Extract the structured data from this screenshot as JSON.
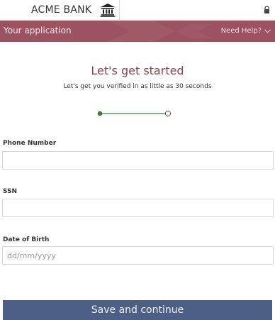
{
  "header": {
    "bank_name": "ACME BANK",
    "bank_icon": "bank-building-icon",
    "lock_icon": "lock-icon"
  },
  "appbar": {
    "title": "Your application",
    "help_label": "Need Help?",
    "help_icon": "chevron-down-icon",
    "color": "#9c5260"
  },
  "main": {
    "heading": "Let's get started",
    "subheading": "Let's get you verified in as little as 30 seconds",
    "steps": {
      "current": 1,
      "total": 2
    }
  },
  "form": {
    "phone": {
      "label": "Phone Number",
      "value": "",
      "placeholder": ""
    },
    "ssn": {
      "label": "SSN",
      "value": "",
      "placeholder": ""
    },
    "dob": {
      "label": "Date of Birth",
      "value": "",
      "placeholder": "dd/mm/yyyy"
    }
  },
  "footer": {
    "save_label": "Save and continue",
    "color": "#4e5f86"
  },
  "colors": {
    "accent": "#8a4450",
    "progress": "#3f7a3f"
  }
}
